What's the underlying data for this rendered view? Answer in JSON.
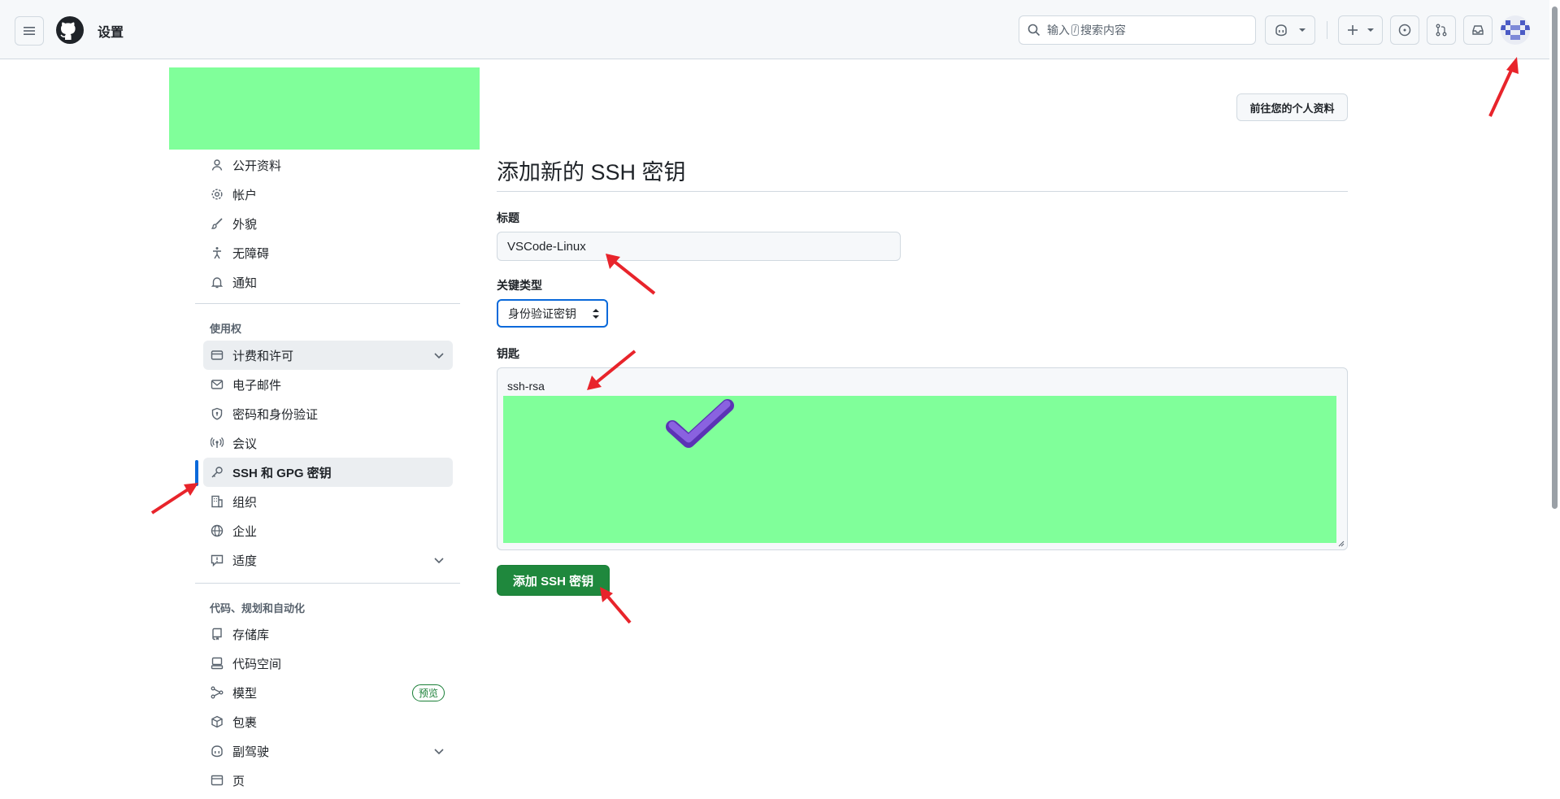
{
  "header": {
    "title": "设置",
    "search_prefix": "输入",
    "search_key": "/",
    "search_suffix": "搜索内容"
  },
  "sidebar": {
    "items_personal": [
      {
        "label": "公开资料",
        "icon": "person-icon"
      },
      {
        "label": "帐户",
        "icon": "gear-icon"
      },
      {
        "label": "外貌",
        "icon": "paintbrush-icon"
      },
      {
        "label": "无障碍",
        "icon": "accessibility-icon"
      },
      {
        "label": "通知",
        "icon": "bell-icon"
      }
    ],
    "section_access": "使用权",
    "items_access": [
      {
        "label": "计费和许可",
        "icon": "credit-card-icon",
        "expandable": true
      },
      {
        "label": "电子邮件",
        "icon": "mail-icon"
      },
      {
        "label": "密码和身份验证",
        "icon": "shield-lock-icon"
      },
      {
        "label": "会议",
        "icon": "broadcast-icon"
      },
      {
        "label": "SSH 和 GPG 密钥",
        "icon": "key-icon",
        "active": true
      },
      {
        "label": "组织",
        "icon": "organization-icon"
      },
      {
        "label": "企业",
        "icon": "globe-icon"
      },
      {
        "label": "适度",
        "icon": "report-icon",
        "expandable": true
      }
    ],
    "section_code": "代码、规划和自动化",
    "items_code": [
      {
        "label": "存储库",
        "icon": "repo-icon"
      },
      {
        "label": "代码空间",
        "icon": "codespaces-icon"
      },
      {
        "label": "模型",
        "icon": "models-icon",
        "badge": "预览"
      },
      {
        "label": "包裹",
        "icon": "package-icon"
      },
      {
        "label": "副驾驶",
        "icon": "copilot-icon",
        "expandable": true
      },
      {
        "label": "页",
        "icon": "browser-icon"
      }
    ]
  },
  "main": {
    "profile_button": "前往您的个人资料",
    "page_title": "添加新的 SSH 密钥",
    "title_label": "标题",
    "title_value": "VSCode-Linux",
    "key_type_label": "关键类型",
    "key_type_value": "身份验证密钥",
    "key_label": "钥匙",
    "key_value": "ssh-rsa",
    "submit_label": "添加 SSH 密钥"
  },
  "colors": {
    "accent": "#0969da",
    "primary_button": "#1f883d",
    "redaction": "#80ff9a",
    "annotation_arrow": "#e8242b",
    "checkmark": "#7b4fd0"
  }
}
